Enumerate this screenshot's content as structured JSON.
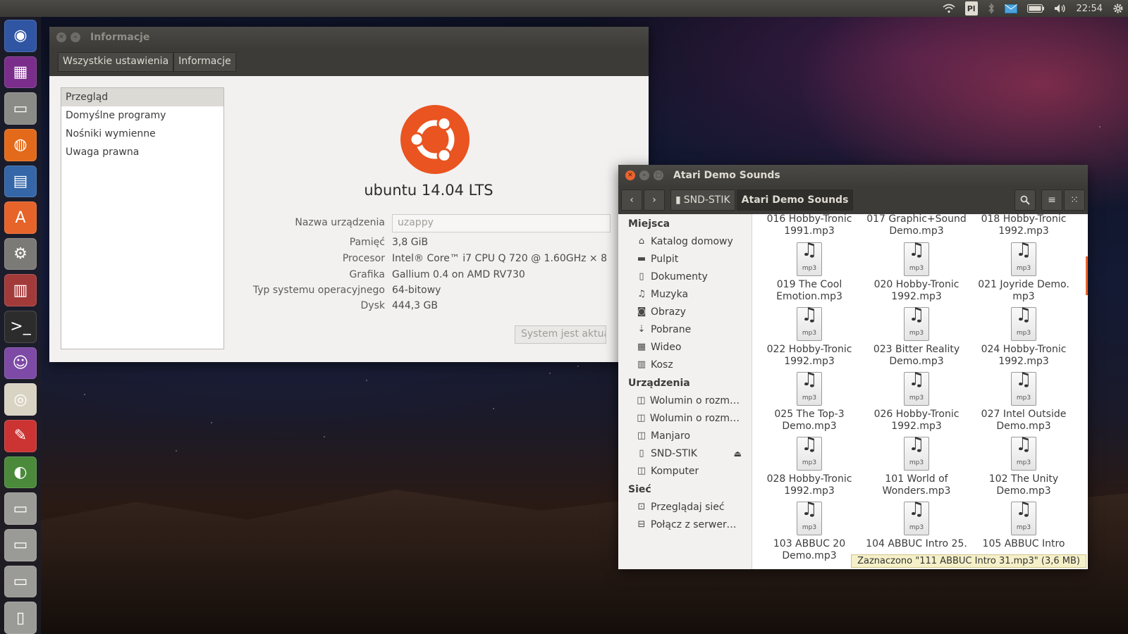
{
  "top_panel": {
    "keyboard_layout": "Pl",
    "clock": "22:54"
  },
  "launcher": {
    "items": [
      {
        "name": "ubuntu-dash",
        "glyph": "◉",
        "color": "#2f55a3"
      },
      {
        "name": "workspace-switcher",
        "glyph": "▦",
        "color": "#7a2d8a"
      },
      {
        "name": "files",
        "glyph": "▭",
        "color": "#8a8a86"
      },
      {
        "name": "firefox",
        "glyph": "◍",
        "color": "#e36a1b"
      },
      {
        "name": "libreoffice-writer",
        "glyph": "▤",
        "color": "#3466a8"
      },
      {
        "name": "software-center",
        "glyph": "A",
        "color": "#e6632a"
      },
      {
        "name": "system-settings",
        "glyph": "⚙",
        "color": "#7c7a76"
      },
      {
        "name": "mixer",
        "glyph": "▥",
        "color": "#a33a3a"
      },
      {
        "name": "terminal",
        "glyph": ">_",
        "color": "#2c2c2c"
      },
      {
        "name": "pidgin",
        "glyph": "☺",
        "color": "#7d4aa6"
      },
      {
        "name": "speakers",
        "glyph": "◎",
        "color": "#d9d3c4"
      },
      {
        "name": "tools",
        "glyph": "✎",
        "color": "#c33"
      },
      {
        "name": "globe",
        "glyph": "◐",
        "color": "#4a8a3a"
      },
      {
        "name": "drive-1",
        "glyph": "▭",
        "color": "#9a9a96"
      },
      {
        "name": "drive-2",
        "glyph": "▭",
        "color": "#9a9a96"
      },
      {
        "name": "drive-3",
        "glyph": "▭",
        "color": "#9a9a96"
      },
      {
        "name": "usb-drive",
        "glyph": "▯",
        "color": "#9a9a96"
      }
    ]
  },
  "info_window": {
    "title": "Informacje",
    "breadcrumbs": [
      "Wszystkie ustawienia",
      "Informacje"
    ],
    "sidebar": [
      "Przegląd",
      "Domyślne programy",
      "Nośniki wymienne",
      "Uwaga prawna"
    ],
    "os_name": "ubuntu 14.04 LTS",
    "device_name_label": "Nazwa urządzenia",
    "device_name_value": "uzappy",
    "specs": [
      {
        "label": "Pamięć",
        "value": "3,8 GiB"
      },
      {
        "label": "Procesor",
        "value": "Intel® Core™ i7 CPU Q 720 @ 1.60GHz × 8"
      },
      {
        "label": "Grafika",
        "value": "Gallium 0.4 on AMD RV730"
      },
      {
        "label": "Typ systemu operacyjnego",
        "value": "64-bitowy"
      },
      {
        "label": "Dysk",
        "value": "444,3 GB"
      }
    ],
    "update_button": "System jest aktual"
  },
  "files_window": {
    "title": "Atari Demo Sounds",
    "path": [
      "SND-STIK",
      "Atari Demo Sounds"
    ],
    "sidebar": {
      "places_header": "Miejsca",
      "places": [
        {
          "label": "Katalog domowy",
          "icon": "home-icon",
          "glyph": "⌂"
        },
        {
          "label": "Pulpit",
          "icon": "folder-icon",
          "glyph": "▬"
        },
        {
          "label": "Dokumenty",
          "icon": "document-icon",
          "glyph": "▯"
        },
        {
          "label": "Muzyka",
          "icon": "music-icon",
          "glyph": "♫"
        },
        {
          "label": "Obrazy",
          "icon": "camera-icon",
          "glyph": "◙"
        },
        {
          "label": "Pobrane",
          "icon": "download-icon",
          "glyph": "⇣"
        },
        {
          "label": "Wideo",
          "icon": "film-icon",
          "glyph": "▦"
        },
        {
          "label": "Kosz",
          "icon": "trash-icon",
          "glyph": "▥"
        }
      ],
      "devices_header": "Urządzenia",
      "devices": [
        {
          "label": "Wolumin o rozmia…",
          "icon": "drive-icon",
          "glyph": "◫"
        },
        {
          "label": "Wolumin o rozmia…",
          "icon": "drive-icon",
          "glyph": "◫"
        },
        {
          "label": "Manjaro",
          "icon": "drive-icon",
          "glyph": "◫"
        },
        {
          "label": "SND-STIK",
          "icon": "usb-icon",
          "glyph": "▯"
        },
        {
          "label": "Komputer",
          "icon": "computer-icon",
          "glyph": "◫"
        }
      ],
      "network_header": "Sieć",
      "network": [
        {
          "label": "Przeglądaj sieć",
          "icon": "network-icon",
          "glyph": "⊡"
        },
        {
          "label": "Połącz z serwerem",
          "icon": "server-icon",
          "glyph": "⊟"
        }
      ]
    },
    "files_top_row": [
      {
        "line1": "016 Hobby-Tronic",
        "line2": "1991.mp3"
      },
      {
        "line1": "017 Graphic+Sound",
        "line2": "Demo.mp3"
      },
      {
        "line1": "018 Hobby-Tronic",
        "line2": "1992.mp3"
      }
    ],
    "files": [
      {
        "line1": "019 The Cool",
        "line2": "Emotion.mp3"
      },
      {
        "line1": "020 Hobby-Tronic",
        "line2": "1992.mp3"
      },
      {
        "line1": "021 Joyride Demo.",
        "line2": "mp3"
      },
      {
        "line1": "022 Hobby-Tronic",
        "line2": "1992.mp3"
      },
      {
        "line1": "023 Bitter Reality",
        "line2": "Demo.mp3"
      },
      {
        "line1": "024 Hobby-Tronic",
        "line2": "1992.mp3"
      },
      {
        "line1": "025 The Top-3",
        "line2": "Demo.mp3"
      },
      {
        "line1": "026 Hobby-Tronic",
        "line2": "1992.mp3"
      },
      {
        "line1": "027 Intel Outside",
        "line2": "Demo.mp3"
      },
      {
        "line1": "028 Hobby-Tronic",
        "line2": "1992.mp3"
      },
      {
        "line1": "101 World of",
        "line2": "Wonders.mp3"
      },
      {
        "line1": "102 The Unity",
        "line2": "Demo.mp3"
      },
      {
        "line1": "103 ABBUC 20",
        "line2": "Demo.mp3"
      },
      {
        "line1": "104 ABBUC Intro 25.",
        "line2": ""
      },
      {
        "line1": "105 ABBUC Intro",
        "line2": ""
      }
    ],
    "file_icon_ext": "mp3",
    "status": "Zaznaczono \"111 ABBUC Intro 31.mp3\" (3,6 MB)"
  }
}
